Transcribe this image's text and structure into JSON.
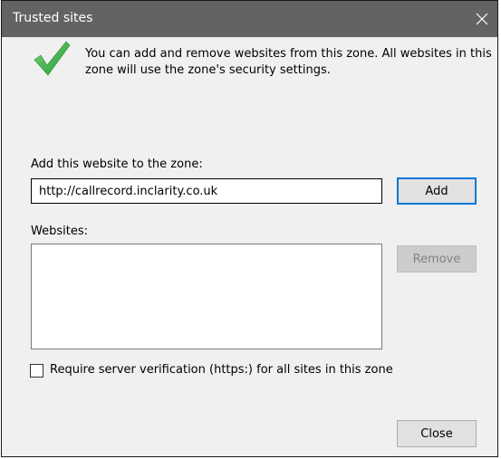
{
  "window": {
    "title": "Trusted sites",
    "close_glyph": "✕",
    "titlebar_color": "#636363"
  },
  "intro": {
    "icon": "checkmark-icon",
    "icon_color": "#3cb44a",
    "text": "You can add and remove websites from this zone. All websites in this zone will use the zone's security settings."
  },
  "add_section": {
    "label": "Add this website to the zone:",
    "input_value": "http://callrecord.inclarity.co.uk",
    "add_button_label": "Add"
  },
  "websites_section": {
    "label": "Websites:",
    "items": [],
    "remove_button_label": "Remove"
  },
  "https_option": {
    "label": "Require server verification (https:) for all sites in this zone",
    "checked": false
  },
  "footer": {
    "close_button_label": "Close"
  }
}
